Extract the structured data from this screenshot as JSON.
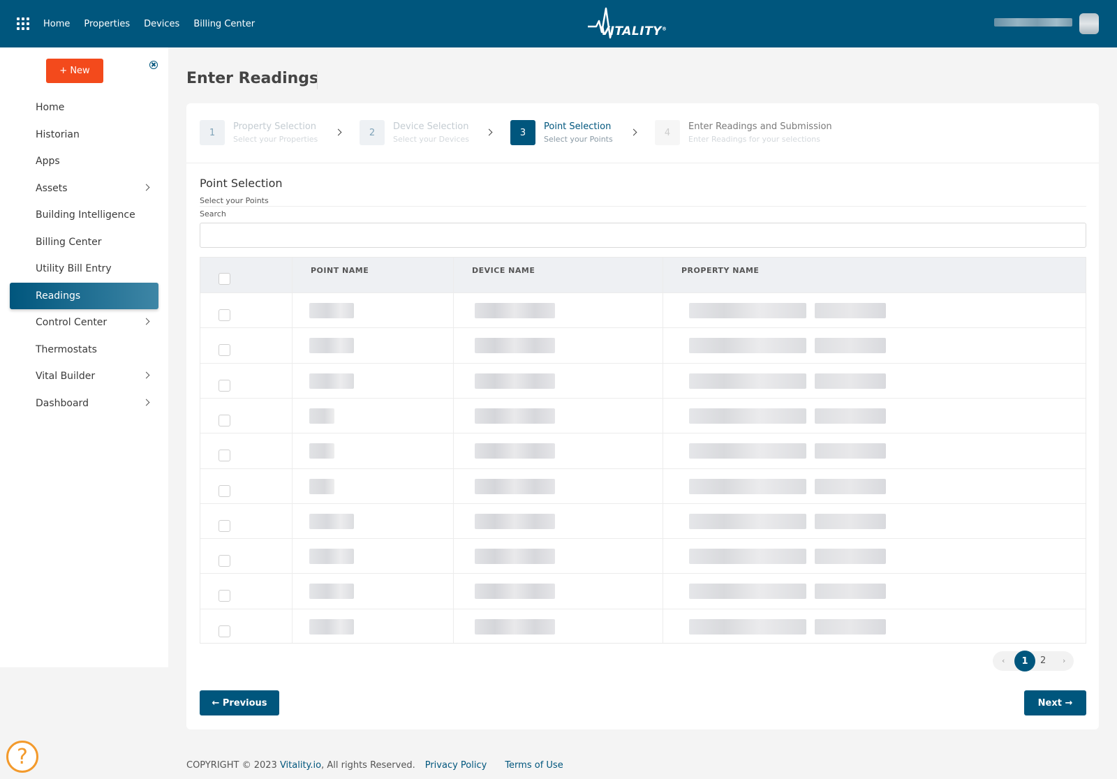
{
  "topbar": {
    "nav": [
      "Home",
      "Properties",
      "Devices",
      "Billing Center"
    ],
    "logo_text": "VITALITY",
    "logo_mark": "®"
  },
  "sidebar": {
    "new_button": "+ New",
    "items": [
      {
        "label": "Home",
        "has_children": false
      },
      {
        "label": "Historian",
        "has_children": false
      },
      {
        "label": "Apps",
        "has_children": false
      },
      {
        "label": "Assets",
        "has_children": true
      },
      {
        "label": "Building Intelligence",
        "has_children": false
      },
      {
        "label": "Billing Center",
        "has_children": false
      },
      {
        "label": "Utility Bill Entry",
        "has_children": false
      },
      {
        "label": "Readings",
        "has_children": false,
        "active": true
      },
      {
        "label": "Control Center",
        "has_children": true
      },
      {
        "label": "Thermostats",
        "has_children": false
      },
      {
        "label": "Vital Builder",
        "has_children": true
      },
      {
        "label": "Dashboard",
        "has_children": true
      }
    ]
  },
  "page": {
    "title": "Enter Readings"
  },
  "stepper": [
    {
      "num": "1",
      "title": "Property Selection",
      "subtitle": "Select your Properties",
      "state": "done"
    },
    {
      "num": "2",
      "title": "Device Selection",
      "subtitle": "Select your Devices",
      "state": "done"
    },
    {
      "num": "3",
      "title": "Point Selection",
      "subtitle": "Select your Points",
      "state": "active"
    },
    {
      "num": "4",
      "title": "Enter Readings and Submission",
      "subtitle": "Enter Readings for your selections",
      "state": "pending"
    }
  ],
  "section": {
    "title": "Point Selection",
    "subtitle": "Select your Points",
    "search_label": "Search",
    "search_value": ""
  },
  "table": {
    "columns": [
      "POINT NAME",
      "DEVICE NAME",
      "PROPERTY NAME"
    ],
    "row_count": 10
  },
  "pagination": {
    "prev": "‹",
    "pages": [
      "1",
      "2"
    ],
    "current": "1",
    "next": "›"
  },
  "buttons": {
    "previous": "← Previous",
    "next": "Next →"
  },
  "footer": {
    "copyright": "COPYRIGHT © 2023",
    "site_link": "Vitality.io",
    "rights": ", All rights Reserved.",
    "privacy": "Privacy Policy",
    "terms": "Terms of Use"
  },
  "colors": {
    "brand": "#00567d",
    "new_button": "#f34a1c",
    "help": "#f39a2c"
  }
}
